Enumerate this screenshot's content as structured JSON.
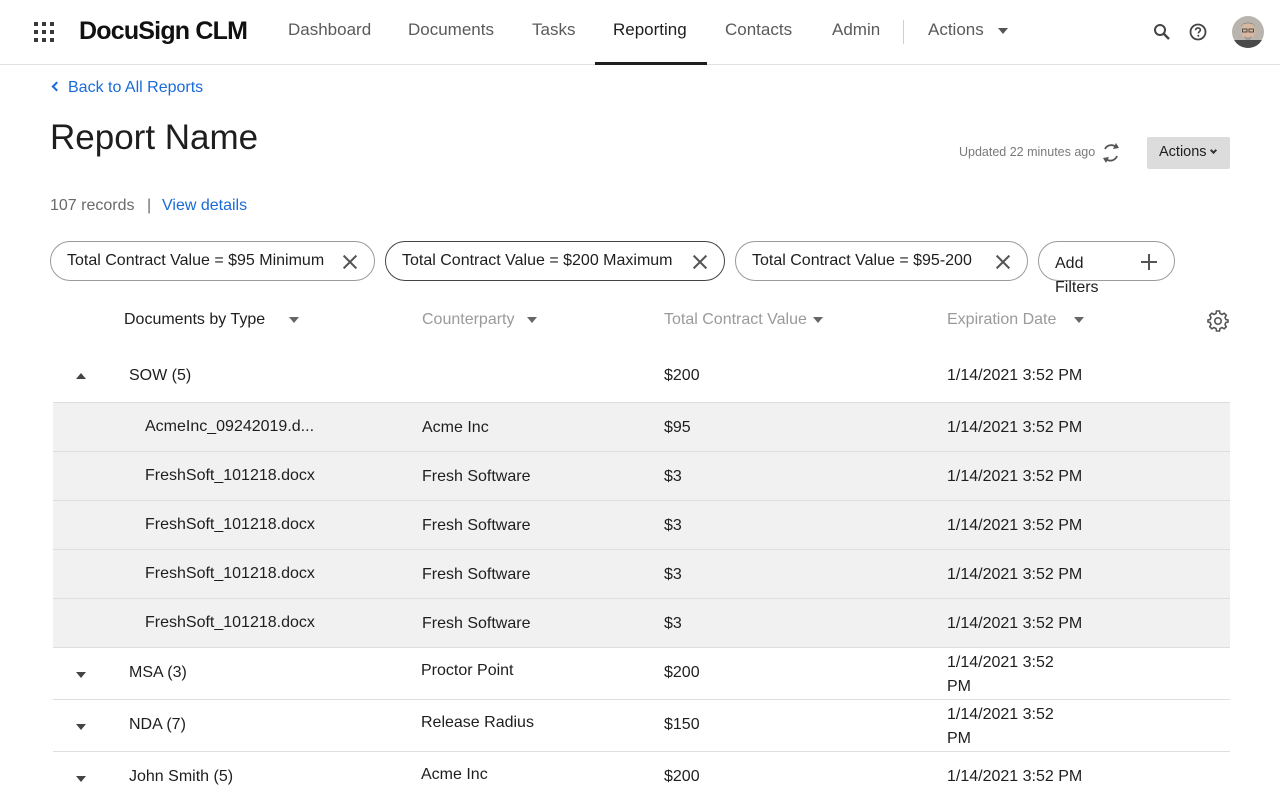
{
  "app": {
    "logo": "DocuSign CLM",
    "nav": [
      "Dashboard",
      "Documents",
      "Tasks",
      "Reporting",
      "Contacts",
      "Admin"
    ],
    "nav_actions": "Actions",
    "active_nav": "Reporting"
  },
  "header": {
    "back_label": "Back to All Reports",
    "title": "Report Name",
    "updated": "Updated 22 minutes ago",
    "actions_label": "Actions",
    "records": "107 records",
    "separator": "|",
    "view_details": "View details"
  },
  "filters": [
    "Total Contract Value = $95 Minimum",
    "Total Contract Value = $200 Maximum",
    "Total Contract Value = $95-200"
  ],
  "add_filters_label": "Add Filters",
  "table": {
    "columns": [
      "Documents by Type",
      "Counterparty",
      "Total Contract Value",
      "Expiration Date"
    ],
    "groups": [
      {
        "name": "SOW (5)",
        "counterparty": "",
        "value": "$200",
        "date": "1/14/2021 3:52 PM",
        "expanded": true,
        "children": [
          {
            "name": "AcmeInc_09242019.d...",
            "counterparty": "Acme Inc",
            "value": "$95",
            "date": "1/14/2021 3:52 PM"
          },
          {
            "name": "FreshSoft_101218.docx",
            "counterparty": "Fresh Software",
            "value": "$3",
            "date": "1/14/2021 3:52 PM"
          },
          {
            "name": "FreshSoft_101218.docx",
            "counterparty": "Fresh Software",
            "value": "$3",
            "date": "1/14/2021 3:52 PM"
          },
          {
            "name": "FreshSoft_101218.docx",
            "counterparty": "Fresh Software",
            "value": "$3",
            "date": "1/14/2021 3:52 PM"
          },
          {
            "name": "FreshSoft_101218.docx",
            "counterparty": "Fresh Software",
            "value": "$3",
            "date": "1/14/2021 3:52 PM"
          }
        ]
      },
      {
        "name": "MSA (3)",
        "counterparty": "Proctor Point",
        "value": "$200",
        "date": "1/14/2021 3:52 PM",
        "expanded": false
      },
      {
        "name": "NDA (7)",
        "counterparty": "Release Radius",
        "value": "$150",
        "date": "1/14/2021 3:52 PM",
        "expanded": false
      },
      {
        "name": "John Smith (5)",
        "counterparty": "Acme Inc",
        "value": "$200",
        "date": "1/14/2021 3:52 PM",
        "expanded": false
      }
    ]
  },
  "icons": {
    "apps": "apps-grid-icon",
    "search": "search-icon",
    "help": "help-icon",
    "refresh": "refresh-icon",
    "settings": "gear-icon"
  },
  "colors": {
    "link": "#1a6ad9",
    "active_nav": "#1e1e1e",
    "child_row_bg": "#f1f1f1",
    "actions_button_bg": "#dcdcdc"
  }
}
